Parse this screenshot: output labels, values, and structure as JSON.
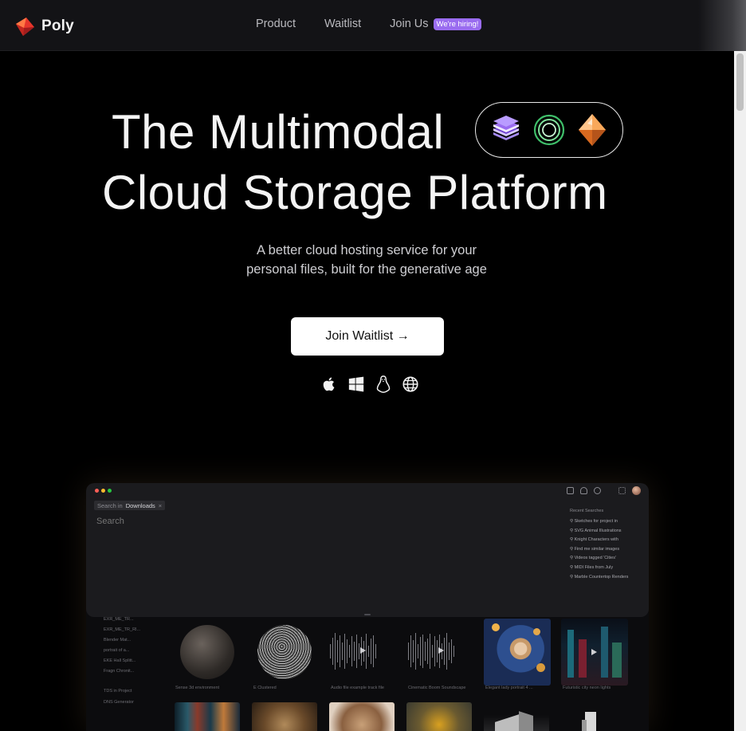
{
  "brand": {
    "name": "Poly"
  },
  "nav": {
    "items": [
      {
        "label": "Product"
      },
      {
        "label": "Waitlist"
      },
      {
        "label": "Join Us"
      }
    ],
    "hiring_badge": "We're hiring!"
  },
  "hero": {
    "title_line1": "The Multimodal",
    "title_line2": "Cloud Storage Platform",
    "subtitle_line1": "A better cloud hosting service for your",
    "subtitle_line2": "personal files, built for the generative age",
    "cta_label": "Join Waitlist →",
    "pill_icons": [
      "layers-stack-icon",
      "concentric-rings-icon",
      "gem-icon"
    ],
    "platform_icons": [
      "apple-icon",
      "windows-icon",
      "linux-icon",
      "globe-icon"
    ]
  },
  "app_preview": {
    "search_chip_prefix": "Search in",
    "search_chip_folder": "Downloads",
    "search_chip_close": "×",
    "search_placeholder": "Search",
    "recent_title": "Recent Searches",
    "recent_searches": [
      "Sketches for project in",
      "SVG Animal Illustrations",
      "Knight Characters with",
      "Find me similar images",
      "Videos tagged 'Cities'",
      "MIDI Files from July",
      "Marble Countertop Renders"
    ],
    "sidebar_items": [
      "EXR_ME_TR...",
      "EXR_ME_TR_RI...",
      "Blender Mat...",
      "portrait of a...",
      "EKE Hall Splitt...",
      "Fragn Chronit...",
      "TDS in Project",
      "DNS Generator"
    ],
    "captions": [
      "Sense 3d environment",
      "E Clustered",
      "Audio file example track file",
      "Cinematic Boom Soundscape",
      "Elegant lady portrait 4 ...",
      "Futuristic city neon lights"
    ]
  },
  "colors": {
    "background": "#000000",
    "header": "#131316",
    "accent_purple": "#9a6cf0",
    "cta_background": "#ffffff"
  }
}
